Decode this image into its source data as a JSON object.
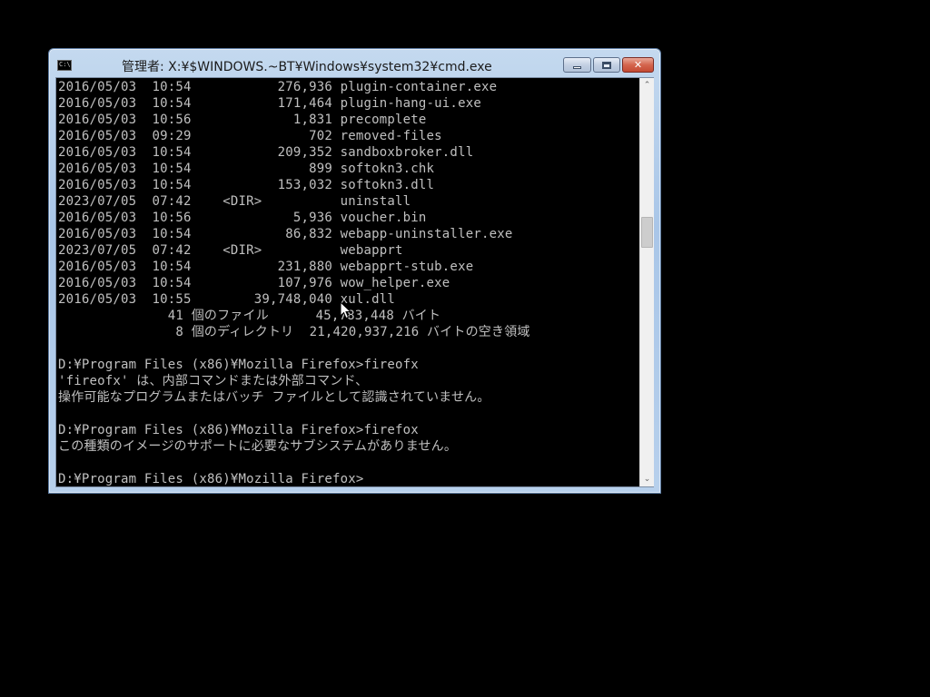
{
  "window": {
    "title": "管理者: X:¥$WINDOWS.~BT¥Windows¥system32¥cmd.exe",
    "icon": "cmd-icon",
    "icon_text": "C:\\",
    "controls": {
      "minimize": "minimize-icon",
      "maximize": "maximize-icon",
      "close": "close-icon",
      "close_glyph": "✕"
    }
  },
  "console": {
    "text_color": "#c0c0c0",
    "background": "#000000",
    "lines": [
      "2016/05/03  10:54           276,936 plugin-container.exe",
      "2016/05/03  10:54           171,464 plugin-hang-ui.exe",
      "2016/05/03  10:56             1,831 precomplete",
      "2016/05/03  09:29               702 removed-files",
      "2016/05/03  10:54           209,352 sandboxbroker.dll",
      "2016/05/03  10:54               899 softokn3.chk",
      "2016/05/03  10:54           153,032 softokn3.dll",
      "2023/07/05  07:42    <DIR>          uninstall",
      "2016/05/03  10:56             5,936 voucher.bin",
      "2016/05/03  10:54            86,832 webapp-uninstaller.exe",
      "2023/07/05  07:42    <DIR>          webapprt",
      "2016/05/03  10:54           231,880 webapprt-stub.exe",
      "2016/05/03  10:54           107,976 wow_helper.exe",
      "2016/05/03  10:55        39,748,040 xul.dll",
      "              41 個のファイル      45,783,448 バイト",
      "               8 個のディレクトリ  21,420,937,216 バイトの空き領域",
      "",
      "D:¥Program Files (x86)¥Mozilla Firefox>fireofx",
      "'fireofx' は、内部コマンドまたは外部コマンド、",
      "操作可能なプログラムまたはバッチ ファイルとして認識されていません。",
      "",
      "D:¥Program Files (x86)¥Mozilla Firefox>firefox",
      "この種類のイメージのサポートに必要なサブシステムがありません。",
      "",
      "D:¥Program Files (x86)¥Mozilla Firefox>"
    ]
  },
  "scrollbar": {
    "up_icon": "scroll-up-arrow-icon",
    "down_icon": "scroll-down-arrow-icon",
    "up_glyph": "⌃",
    "down_glyph": "⌄"
  },
  "pointer": {
    "icon": "mouse-pointer-icon"
  }
}
